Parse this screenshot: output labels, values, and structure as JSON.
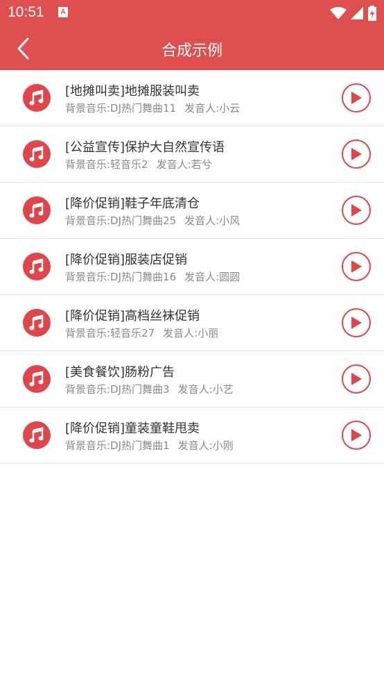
{
  "status_bar": {
    "time": "10:51",
    "notification_icon_letter": "A",
    "icons": [
      "wifi-icon",
      "signal-icon",
      "battery-icon"
    ]
  },
  "header": {
    "title": "合成示例",
    "back_icon": "chevron-left-icon",
    "background_color": "#e04f4f"
  },
  "accent_color": "#e0454a",
  "items": [
    {
      "title": "[地摊叫卖]地摊服装叫卖",
      "bgm": "背景音乐:DJ热门舞曲11",
      "speaker": "发音人:小云"
    },
    {
      "title": "[公益宣传]保护大自然宣传语",
      "bgm": "背景音乐:轻音乐2",
      "speaker": "发音人:若兮"
    },
    {
      "title": "[降价促销]鞋子年底清仓",
      "bgm": "背景音乐:DJ热门舞曲25",
      "speaker": "发音人:小风"
    },
    {
      "title": "[降价促销]服装店促销",
      "bgm": "背景音乐:DJ热门舞曲16",
      "speaker": "发音人:圆圆"
    },
    {
      "title": "[降价促销]高档丝袜促销",
      "bgm": "背景音乐:轻音乐27",
      "speaker": "发音人:小丽"
    },
    {
      "title": "[美食餐饮]肠粉广告",
      "bgm": "背景音乐:DJ热门舞曲3",
      "speaker": "发音人:小艺"
    },
    {
      "title": "[降价促销]童装童鞋甩卖",
      "bgm": "背景音乐:DJ热门舞曲1",
      "speaker": "发音人:小刚"
    }
  ]
}
